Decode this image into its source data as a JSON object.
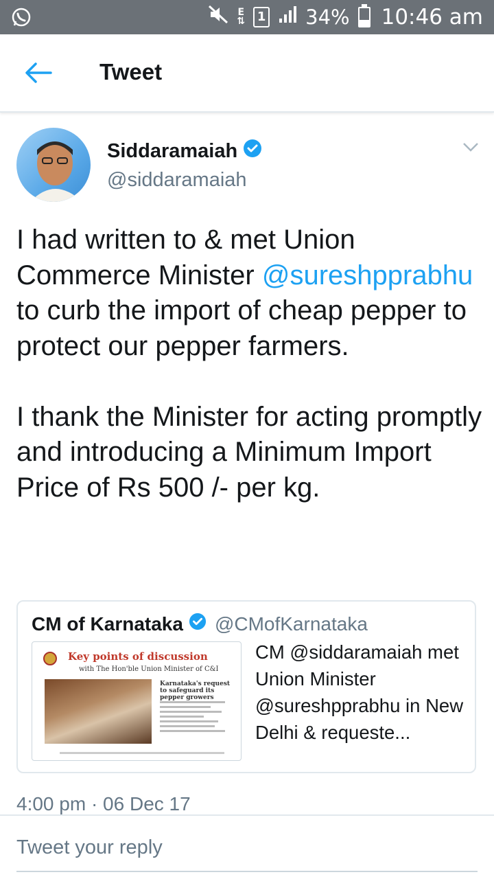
{
  "status_bar": {
    "battery": "34%",
    "battery_level": 0.34,
    "time": "10:46 am",
    "sim": "1",
    "network": "E",
    "icons": [
      "whatsapp-icon",
      "mute-icon",
      "signal-icon",
      "battery-icon"
    ]
  },
  "header": {
    "title": "Tweet"
  },
  "tweet": {
    "author_name": "Siddaramaiah",
    "author_handle": "@siddaramaiah",
    "text_before": "I had written to & met Union Commerce Minister ",
    "mention": "@sureshpprabhu",
    "text_after": " to curb the import of cheap pepper to protect our pepper farmers.\n\nI thank the Minister for acting promptly and introducing a Minimum Import Price of Rs 500 /- per kg.",
    "timestamp": "4:00 pm · 06 Dec 17"
  },
  "quoted_tweet": {
    "author_name": "CM of Karnataka",
    "author_handle": "@CMofKarnataka",
    "text": "CM @siddaramaiah met Union Minister @sureshpprabhu in New Delhi & requeste...",
    "image": {
      "heading": "Key points of discussion",
      "subheading": "with The Hon'ble Union Minister of C&I",
      "request_title": "Karnataka's request to safeguard its pepper growers"
    }
  },
  "reply": {
    "placeholder": "Tweet your reply"
  },
  "colors": {
    "accent": "#1da1f2",
    "status_bar": "#6b7177",
    "secondary_text": "#657786"
  }
}
